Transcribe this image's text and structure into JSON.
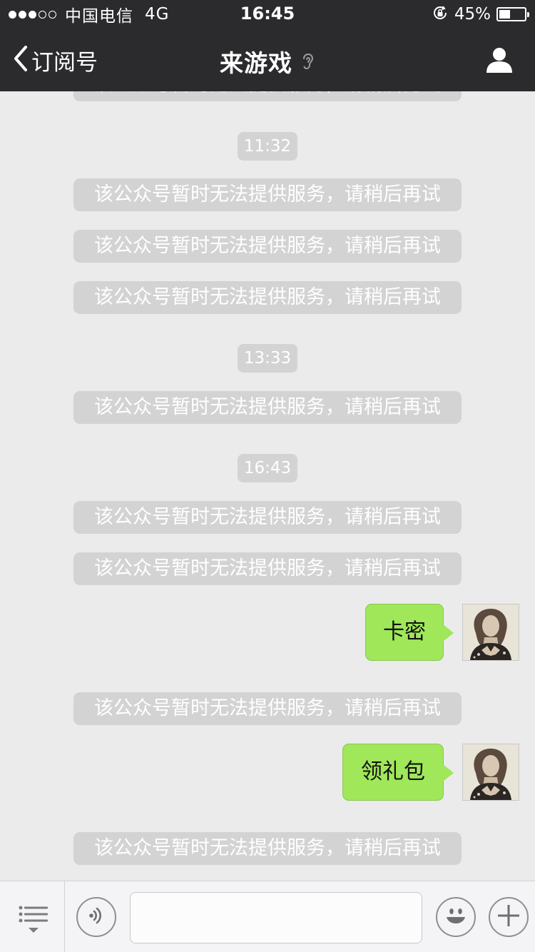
{
  "status_bar": {
    "signal_dots_filled": 3,
    "signal_dots_total": 5,
    "carrier": "中国电信",
    "network": "4G",
    "time": "16:45",
    "battery_pct_text": "45%",
    "battery_level": 0.45
  },
  "nav": {
    "back_label": "订阅号",
    "title": "来游戏",
    "ear_icon": "ear-icon",
    "profile_icon": "person-icon"
  },
  "messages": {
    "partial_top": "该公众号暂时无法提供服务，请稍后再试",
    "time_1": "11:32",
    "sys_1": "该公众号暂时无法提供服务，请稍后再试",
    "sys_2": "该公众号暂时无法提供服务，请稍后再试",
    "sys_3": "该公众号暂时无法提供服务，请稍后再试",
    "time_2": "13:33",
    "sys_4": "该公众号暂时无法提供服务，请稍后再试",
    "time_3": "16:43",
    "sys_5": "该公众号暂时无法提供服务，请稍后再试",
    "sys_6": "该公众号暂时无法提供服务，请稍后再试",
    "user_1": "卡密",
    "sys_7": "该公众号暂时无法提供服务，请稍后再试",
    "user_2": "领礼包",
    "sys_8": "该公众号暂时无法提供服务，请稍后再试"
  },
  "toolbar": {
    "input_value": "",
    "menu_icon": "menu-icon",
    "voice_icon": "voice-icon",
    "emoji_icon": "emoji-icon",
    "add_icon": "plus-icon"
  },
  "colors": {
    "bar_bg": "#2b2b2d",
    "chat_bg": "#ebebeb",
    "system_bubble": "#d3d3d3",
    "user_bubble": "#a0e75a"
  }
}
